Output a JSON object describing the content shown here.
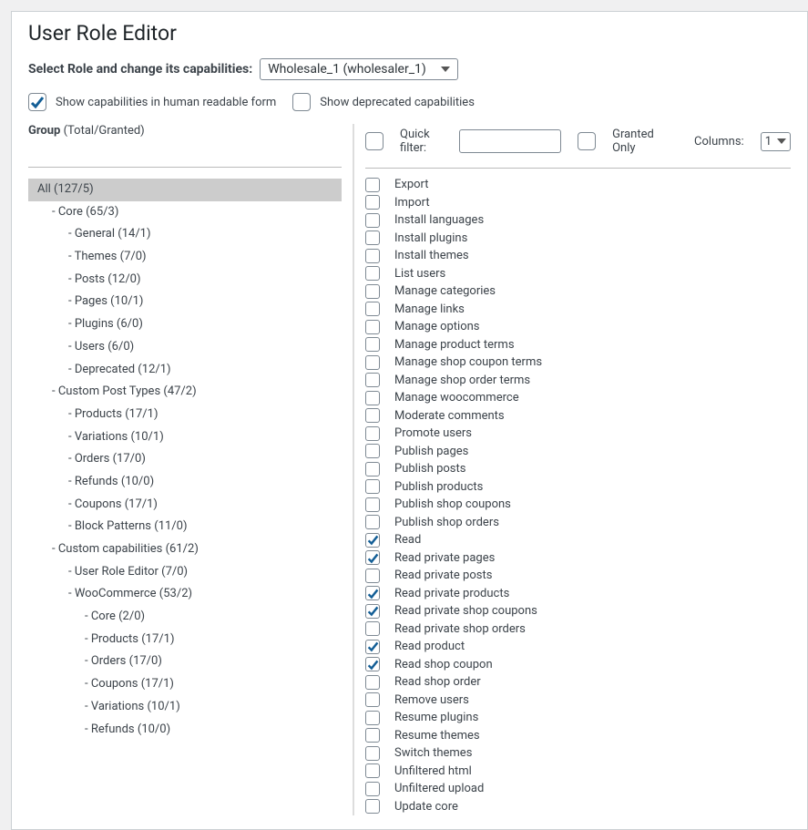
{
  "page_title": "User Role Editor",
  "select_label": "Select Role and change its capabilities:",
  "selected_role": "Wholesale_1 (wholesaler_1)",
  "opt_human_readable": {
    "label": "Show capabilities in human readable form",
    "checked": true
  },
  "opt_deprecated": {
    "label": "Show deprecated capabilities",
    "checked": false
  },
  "group_label": "Group",
  "group_hint": "(Total/Granted)",
  "quick_filter_label": "Quick filter:",
  "granted_only_label": "Granted Only",
  "columns_label": "Columns:",
  "columns_value": "1",
  "tree": [
    {
      "label": "All (127/5)",
      "level": 0,
      "selected": true,
      "dash": false
    },
    {
      "label": "Core (65/3)",
      "level": 1,
      "dash": true
    },
    {
      "label": "General (14/1)",
      "level": 2,
      "dash": true
    },
    {
      "label": "Themes (7/0)",
      "level": 2,
      "dash": true
    },
    {
      "label": "Posts (12/0)",
      "level": 2,
      "dash": true
    },
    {
      "label": "Pages (10/1)",
      "level": 2,
      "dash": true
    },
    {
      "label": "Plugins (6/0)",
      "level": 2,
      "dash": true
    },
    {
      "label": "Users (6/0)",
      "level": 2,
      "dash": true
    },
    {
      "label": "Deprecated (12/1)",
      "level": 2,
      "dash": true
    },
    {
      "label": "Custom Post Types (47/2)",
      "level": 1,
      "dash": true
    },
    {
      "label": "Products (17/1)",
      "level": 2,
      "dash": true
    },
    {
      "label": "Variations (10/1)",
      "level": 2,
      "dash": true
    },
    {
      "label": "Orders (17/0)",
      "level": 2,
      "dash": true
    },
    {
      "label": "Refunds (10/0)",
      "level": 2,
      "dash": true
    },
    {
      "label": "Coupons (17/1)",
      "level": 2,
      "dash": true
    },
    {
      "label": "Block Patterns (11/0)",
      "level": 2,
      "dash": true
    },
    {
      "label": "Custom capabilities (61/2)",
      "level": 1,
      "dash": true
    },
    {
      "label": "User Role Editor (7/0)",
      "level": 2,
      "dash": true
    },
    {
      "label": "WooCommerce (53/2)",
      "level": 2,
      "dash": true
    },
    {
      "label": "Core (2/0)",
      "level": 3,
      "dash": true
    },
    {
      "label": "Products (17/1)",
      "level": 3,
      "dash": true
    },
    {
      "label": "Orders (17/0)",
      "level": 3,
      "dash": true
    },
    {
      "label": "Coupons (17/1)",
      "level": 3,
      "dash": true
    },
    {
      "label": "Variations (10/1)",
      "level": 3,
      "dash": true
    },
    {
      "label": "Refunds (10/0)",
      "level": 3,
      "dash": true
    }
  ],
  "capabilities": [
    {
      "label": "Export",
      "checked": false
    },
    {
      "label": "Import",
      "checked": false
    },
    {
      "label": "Install languages",
      "checked": false
    },
    {
      "label": "Install plugins",
      "checked": false
    },
    {
      "label": "Install themes",
      "checked": false
    },
    {
      "label": "List users",
      "checked": false
    },
    {
      "label": "Manage categories",
      "checked": false
    },
    {
      "label": "Manage links",
      "checked": false
    },
    {
      "label": "Manage options",
      "checked": false
    },
    {
      "label": "Manage product terms",
      "checked": false
    },
    {
      "label": "Manage shop coupon terms",
      "checked": false
    },
    {
      "label": "Manage shop order terms",
      "checked": false
    },
    {
      "label": "Manage woocommerce",
      "checked": false
    },
    {
      "label": "Moderate comments",
      "checked": false
    },
    {
      "label": "Promote users",
      "checked": false
    },
    {
      "label": "Publish pages",
      "checked": false
    },
    {
      "label": "Publish posts",
      "checked": false
    },
    {
      "label": "Publish products",
      "checked": false
    },
    {
      "label": "Publish shop coupons",
      "checked": false
    },
    {
      "label": "Publish shop orders",
      "checked": false
    },
    {
      "label": "Read",
      "checked": true
    },
    {
      "label": "Read private pages",
      "checked": true
    },
    {
      "label": "Read private posts",
      "checked": false
    },
    {
      "label": "Read private products",
      "checked": true
    },
    {
      "label": "Read private shop coupons",
      "checked": true
    },
    {
      "label": "Read private shop orders",
      "checked": false
    },
    {
      "label": "Read product",
      "checked": true
    },
    {
      "label": "Read shop coupon",
      "checked": true
    },
    {
      "label": "Read shop order",
      "checked": false
    },
    {
      "label": "Remove users",
      "checked": false
    },
    {
      "label": "Resume plugins",
      "checked": false
    },
    {
      "label": "Resume themes",
      "checked": false
    },
    {
      "label": "Switch themes",
      "checked": false
    },
    {
      "label": "Unfiltered html",
      "checked": false
    },
    {
      "label": "Unfiltered upload",
      "checked": false
    },
    {
      "label": "Update core",
      "checked": false
    }
  ]
}
